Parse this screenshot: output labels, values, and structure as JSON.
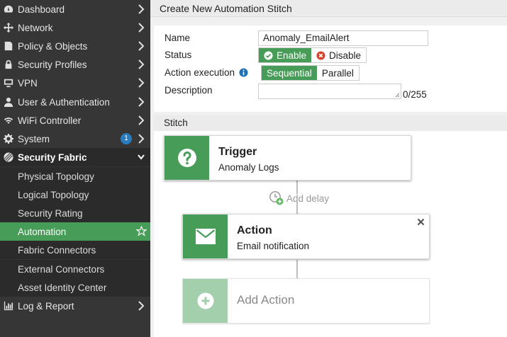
{
  "sidebar": {
    "items": [
      {
        "label": "Dashboard",
        "icon": "dashboard-icon"
      },
      {
        "label": "Network",
        "icon": "network-icon"
      },
      {
        "label": "Policy & Objects",
        "icon": "policy-icon"
      },
      {
        "label": "Security Profiles",
        "icon": "lock-icon"
      },
      {
        "label": "VPN",
        "icon": "monitor-icon"
      },
      {
        "label": "User & Authentication",
        "icon": "user-icon"
      },
      {
        "label": "WiFi Controller",
        "icon": "wifi-icon"
      },
      {
        "label": "System",
        "icon": "gear-icon",
        "badge": "1"
      },
      {
        "label": "Security Fabric",
        "icon": "fabric-icon"
      },
      {
        "label": "Log & Report",
        "icon": "chart-icon"
      }
    ],
    "fabric_subitems": [
      "Physical Topology",
      "Logical Topology",
      "Security Rating",
      "Automation",
      "Fabric Connectors",
      "External Connectors",
      "Asset Identity Center"
    ],
    "active_item": "Automation"
  },
  "page": {
    "title": "Create New Automation Stitch"
  },
  "form": {
    "name_label": "Name",
    "name_value": "Anomaly_EmailAlert",
    "status_label": "Status",
    "status_enable": "Enable",
    "status_disable": "Disable",
    "action_exec_label": "Action execution",
    "exec_sequential": "Sequential",
    "exec_parallel": "Parallel",
    "description_label": "Description",
    "description_value": "",
    "description_count": "0/255"
  },
  "stitch": {
    "header": "Stitch",
    "trigger_title": "Trigger",
    "trigger_sub": "Anomaly Logs",
    "add_delay": "Add delay",
    "action_title": "Action",
    "action_sub": "Email notification",
    "add_action": "Add Action"
  },
  "colors": {
    "accent_green": "#479c57",
    "sidebar_bg": "#363636",
    "badge_blue": "#2a7bbd"
  }
}
